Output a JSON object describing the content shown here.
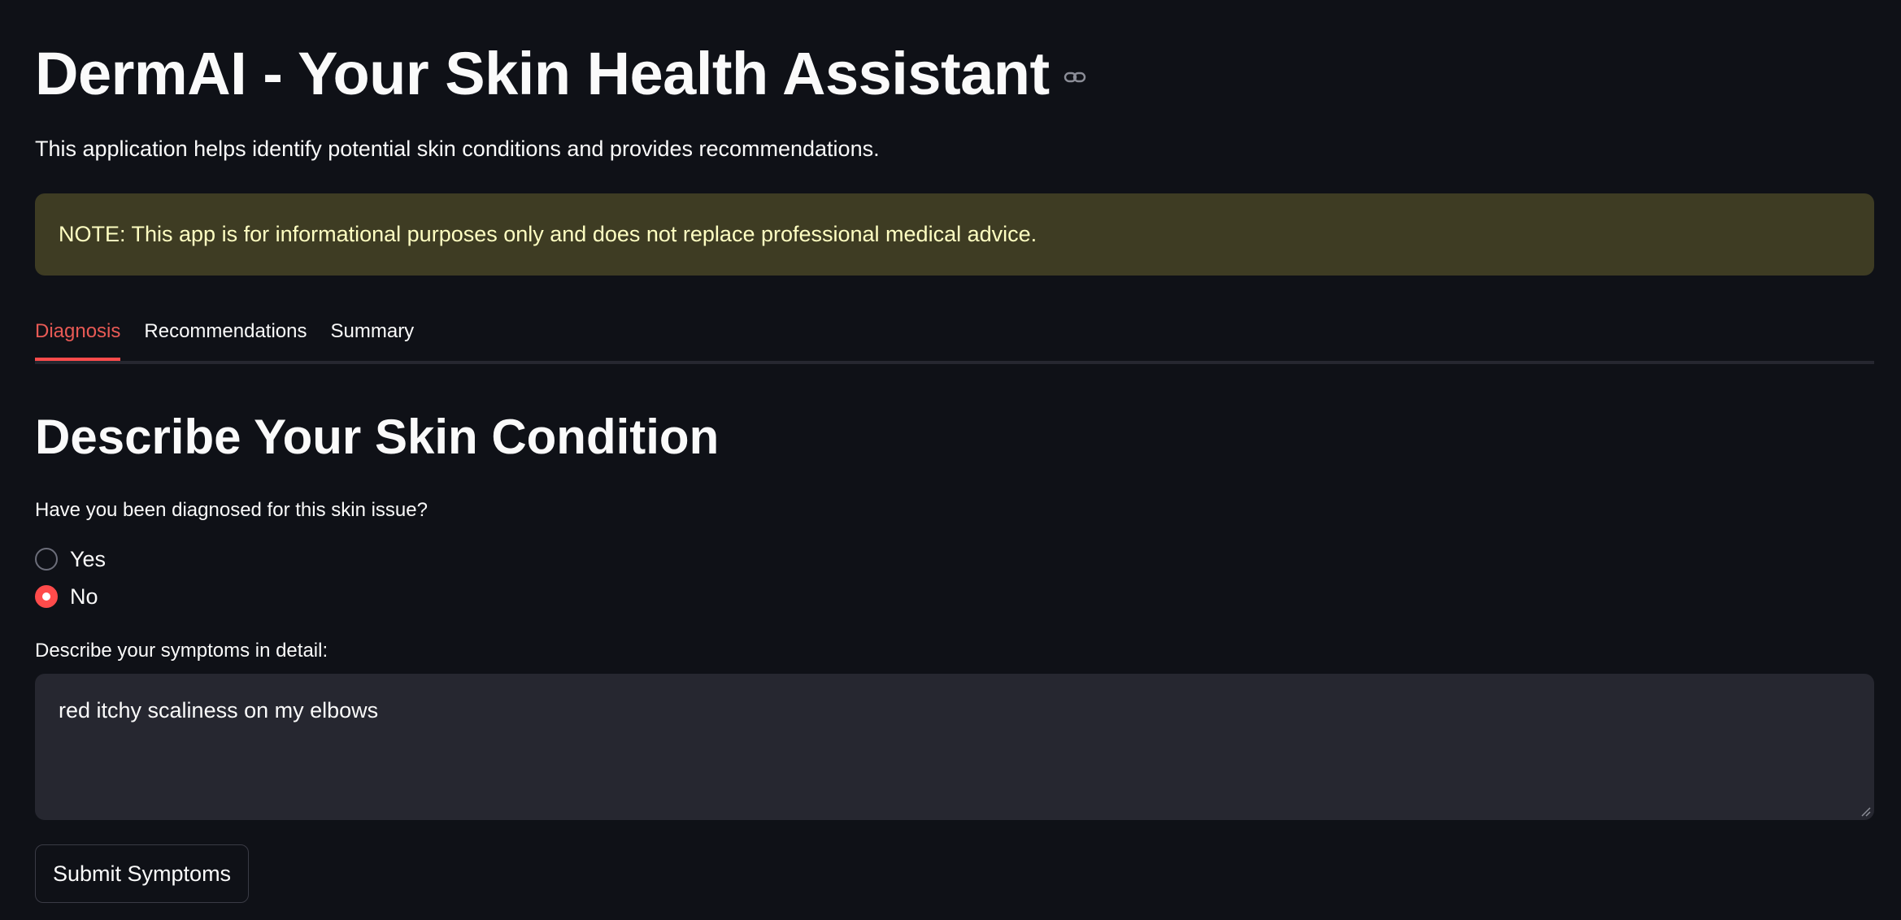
{
  "app": {
    "title": "DermAI - Your Skin Health Assistant",
    "subtitle": "This application helps identify potential skin conditions and provides recommendations.",
    "note": "NOTE: This app is for informational purposes only and does not replace professional medical advice."
  },
  "tabs": [
    {
      "label": "Diagnosis",
      "active": true
    },
    {
      "label": "Recommendations",
      "active": false
    },
    {
      "label": "Summary",
      "active": false
    }
  ],
  "diagnosis": {
    "section_title": "Describe Your Skin Condition",
    "question": "Have you been diagnosed for this skin issue?",
    "options": [
      {
        "label": "Yes",
        "selected": false
      },
      {
        "label": "No",
        "selected": true
      }
    ],
    "symptoms_label": "Describe your symptoms in detail:",
    "symptoms_value": "red itchy scaliness on my elbows",
    "submit_label": "Submit Symptoms"
  },
  "colors": {
    "background": "#0f1117",
    "accent": "#ff4b4b",
    "note_background": "#3e3c23",
    "note_text": "#ffffc2",
    "input_background": "#262730"
  },
  "icons": {
    "title_anchor": "link-icon",
    "textarea_resize": "resize-handle-icon"
  }
}
